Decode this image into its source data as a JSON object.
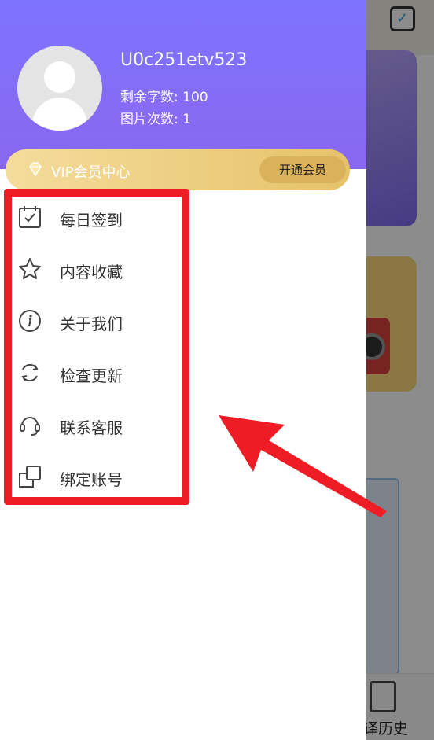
{
  "background": {
    "bottom_tab_label": "译历史",
    "colors": {
      "card_purple": "#9a89fb",
      "card_yellow": "#fbd97a",
      "accent_blue": "#2b9be5"
    },
    "icons": [
      "calendar-check-icon",
      "history-icon"
    ]
  },
  "drawer": {
    "user": {
      "username": "U0c251etv523",
      "words_left": "剩余字数: 100",
      "image_count": "图片次数: 1",
      "avatar_icon": "default-avatar-icon"
    },
    "vip": {
      "label": "VIP会员中心",
      "button_label": "开通会员",
      "icon": "diamond-icon",
      "color": "#e6c36a"
    },
    "menu": [
      {
        "label": "每日签到",
        "icon": "calendar-check-icon"
      },
      {
        "label": "内容收藏",
        "icon": "star-icon"
      },
      {
        "label": "关于我们",
        "icon": "info-icon"
      },
      {
        "label": "检查更新",
        "icon": "refresh-icon"
      },
      {
        "label": "联系客服",
        "icon": "headset-icon"
      },
      {
        "label": "绑定账号",
        "icon": "link-account-icon"
      }
    ],
    "header_color": "#7e73ff"
  },
  "annotation": {
    "highlight_color": "#ee1c25",
    "arrow_color": "#ee1c25"
  }
}
